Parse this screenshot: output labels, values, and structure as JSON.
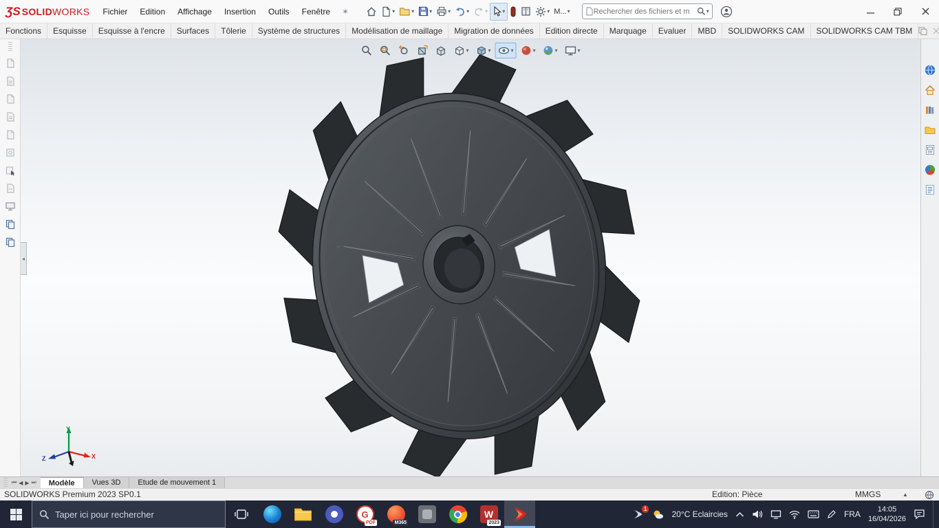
{
  "colors": {
    "brand_red": "#d1181e",
    "taskbar_bg": "#212636",
    "selection_blue": "#cfe4f7"
  },
  "menubar": {
    "logo_ds": "ƷS",
    "logo_solid": "SOLID",
    "logo_works": "WORKS",
    "menus": [
      "Fichier",
      "Edition",
      "Affichage",
      "Insertion",
      "Outils",
      "Fenêtre"
    ],
    "user_menu": "M...",
    "search_placeholder": "Rechercher des fichiers et m"
  },
  "ribbon": {
    "tabs": [
      "Fonctions",
      "Esquisse",
      "Esquisse à l'encre",
      "Surfaces",
      "Tôlerie",
      "Système de structures",
      "Modélisation de maillage",
      "Migration de données",
      "Edition directe",
      "Marquage",
      "Evaluer",
      "MBD",
      "SOLIDWORKS CAM",
      "SOLIDWORKS CAM TBM"
    ]
  },
  "doc_tabs": [
    "Modèle",
    "Vues 3D",
    "Etude de mouvement 1"
  ],
  "status_bar": {
    "product": "SOLIDWORKS Premium 2023 SP0.1",
    "edition": "Edition: Pièce",
    "units": "MMGS"
  },
  "taskbar": {
    "search_placeholder": "Taper ici pour rechercher",
    "notification_badge": "1",
    "weather": "20°C Eclaircies",
    "language": "FRA",
    "time": "14:05",
    "date": "16/04/2026",
    "badges": {
      "pdf": "PDF",
      "m365": "M365",
      "word": "2023"
    },
    "word_letter": "W"
  },
  "triad_labels": {
    "x": "X",
    "y": "Y",
    "z": "Z"
  }
}
